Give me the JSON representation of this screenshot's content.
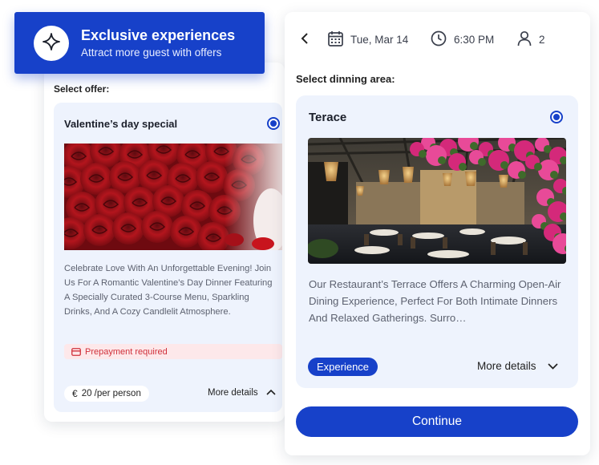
{
  "banner": {
    "title": "Exclusive experiences",
    "subtitle": "Attract more guest with offers",
    "icon": "sparkle-icon"
  },
  "offers_panel": {
    "select_label": "Select offer:",
    "offer": {
      "title": "Valentine’s day special",
      "selected": true,
      "image": "red-roses",
      "description": "Celebrate Love With An Unforgettable Evening! Join Us For A Romantic Valentine’s Day Dinner Featuring A Specially Curated 3-Course Menu, Sparkling Drinks, And A Cozy Candlelit Atmosphere.",
      "prepayment_label": "Prepayment required",
      "price_currency": "€",
      "price_text": "20 /per person",
      "more_details_label": "More details"
    }
  },
  "booking": {
    "date": "Tue, Mar 14",
    "time": "6:30 PM",
    "guests": "2",
    "area_label": "Select dinning area:",
    "area": {
      "title": "Terace",
      "selected": true,
      "image": "terrace-restaurant",
      "description": "Our Restaurant’s Terrace Offers A Charming Open-Air Dining Experience, Perfect For Both Intimate Dinners And Relaxed Gatherings. Surro…",
      "badge": "Experience",
      "more_details_label": "More details"
    },
    "continue_label": "Continue"
  },
  "colors": {
    "primary": "#1741c9",
    "card_bg": "#eef3fd",
    "danger": "#d0303a",
    "danger_bg": "#fde8ea"
  }
}
